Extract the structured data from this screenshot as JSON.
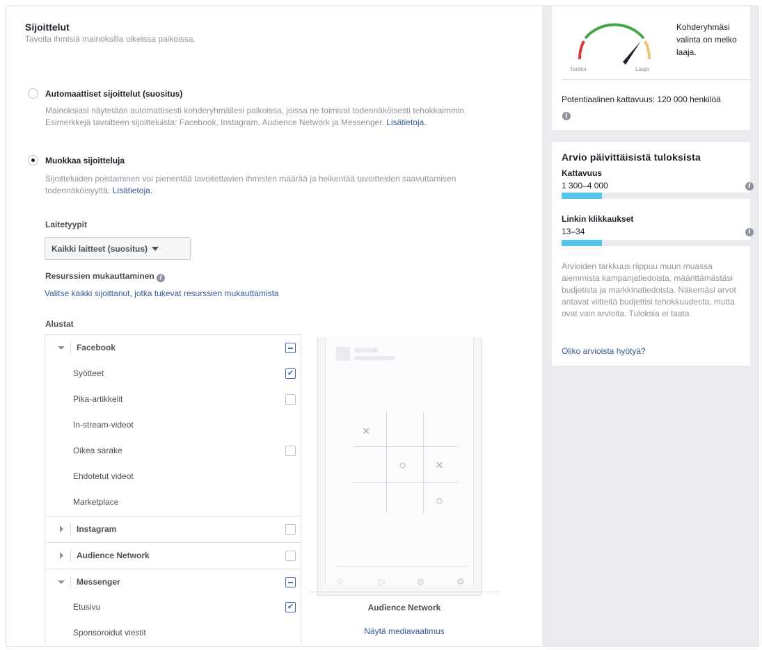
{
  "section": {
    "title": "Sijoittelut",
    "subtitle": "Tavoita ihmisiä mainoksilla oikeissa paikoissa."
  },
  "auto_placement": {
    "label": "Automaattiset sijoittelut (suositus)",
    "description": "Mainoksiasi näytetään automattisesti kohderyhmällesi paikoissa, joissa ne toimivat todennäköisesti tehokkaimmin. Esimerkkejä tavoitteen sijoitteluista: Facebook, Instagram, Audience Network ja Messenger.",
    "link": "Lisätietoja.",
    "selected": false
  },
  "edit_placement": {
    "label": "Muokkaa sijoitteluja",
    "description": "Sijoitteluiden poistaminen voi pienentää tavoitettavien ihmisten määrää ja heikentää tavoitteiden saavuttamisen todennäköisyyttä.",
    "link": "Lisätietoja.",
    "selected": true
  },
  "device_types": {
    "label": "Laitetyypit",
    "value": "Kaikki laitteet (suositus)"
  },
  "asset_customization": {
    "label": "Resurssien mukauttaminen",
    "link": "Valitse kaikki sijoittanut, jotka tukevat resurssien mukauttamista"
  },
  "platforms": {
    "label": "Alustat",
    "facebook": {
      "name": "Facebook",
      "items": [
        "Syötteet",
        "Pika-artikkelit",
        "In-stream-videot",
        "Oikea sarake",
        "Ehdotetut videot",
        "Marketplace"
      ]
    },
    "instagram": {
      "name": "Instagram"
    },
    "audience_network": {
      "name": "Audience Network"
    },
    "messenger": {
      "name": "Messenger",
      "items": [
        "Etusivu",
        "Sponsoroidut viestit"
      ]
    }
  },
  "preview": {
    "marks": [
      "×",
      "○",
      "×",
      "○"
    ],
    "caption": "Audience Network",
    "link": "Näytä mediavaatimus"
  },
  "audience": {
    "gauge_left": "Tarkka",
    "gauge_right": "Laaja",
    "description": "Kohderyhmäsi valinta on melko laaja.",
    "potential_reach": "Potentiaalinen kattavuus: 120 000 henkilöä"
  },
  "estimates": {
    "title": "Arvio päivittäisistä tuloksista",
    "reach_label": "Kattavuus",
    "reach_value": "1 300–4 000",
    "clicks_label": "Linkin klikkaukset",
    "clicks_value": "13–34",
    "note": "Arvioiden tarkkuus riippuu muun muassa aiemmista kampanjatiedoista, määrittämästäsi budjetista ja markkinatiedoista. Näkemäsi arvot antavat viitteitä budjettisi tehokkuudesta, mutta ovat vain arvioita. Tuloksia ei taata.",
    "helpful_link": "Oliko arvioista hyötyä?"
  },
  "colors": {
    "link": "#365899",
    "bar_fill": "#52c5e8",
    "checkbox": "#4267b2"
  }
}
